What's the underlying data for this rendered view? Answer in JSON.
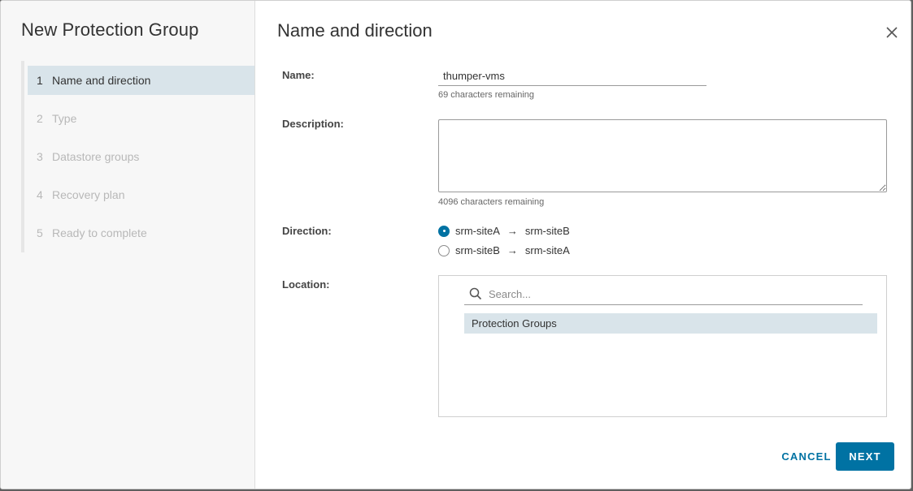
{
  "wizard": {
    "title": "New Protection Group",
    "steps": [
      {
        "num": "1",
        "label": "Name and direction",
        "active": true
      },
      {
        "num": "2",
        "label": "Type",
        "active": false
      },
      {
        "num": "3",
        "label": "Datastore groups",
        "active": false
      },
      {
        "num": "4",
        "label": "Recovery plan",
        "active": false
      },
      {
        "num": "5",
        "label": "Ready to complete",
        "active": false
      }
    ]
  },
  "page": {
    "title": "Name and direction",
    "close_icon": "close-icon"
  },
  "form": {
    "name": {
      "label": "Name:",
      "value": "thumper-vms",
      "hint": "69 characters remaining"
    },
    "description": {
      "label": "Description:",
      "value": "",
      "hint": "4096 characters remaining"
    },
    "direction": {
      "label": "Direction:",
      "options": [
        {
          "from": "srm-siteA",
          "arrow": "→",
          "to": "srm-siteB",
          "checked": true
        },
        {
          "from": "srm-siteB",
          "arrow": "→",
          "to": "srm-siteA",
          "checked": false
        }
      ]
    },
    "location": {
      "label": "Location:",
      "search_placeholder": "Search...",
      "search_icon": "search-icon",
      "tree_items": [
        {
          "label": "Protection Groups",
          "selected": true
        }
      ]
    }
  },
  "footer": {
    "cancel_label": "CANCEL",
    "next_label": "NEXT"
  },
  "colors": {
    "accent": "#0072a3",
    "selected_bg": "#d9e4ea",
    "disabled_text": "#b8b8b8"
  }
}
